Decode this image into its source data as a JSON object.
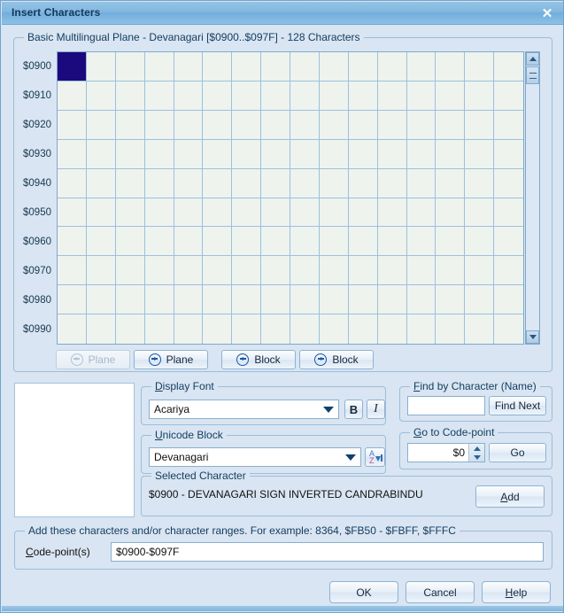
{
  "window": {
    "title": "Insert Characters",
    "close_icon": "close-icon"
  },
  "grid_panel": {
    "legend_prefix": "Basic Multilingual Plane - Devanagari [$0900..$097F] - 128 Characters",
    "legend_plain": "Basic Multilingual Plane - Devanagari [$0900..$097F] - 128 Characters",
    "row_labels": [
      "$0900",
      "$0910",
      "$0920",
      "$0930",
      "$0940",
      "$0950",
      "$0960",
      "$0970",
      "$0980",
      "$0990"
    ],
    "columns": 16,
    "rows": 10,
    "selected_index": 0,
    "selected_color": "#1b0a7d",
    "cell_background": "#eef3ee",
    "gridline_color": "#9dc0dd",
    "scrollbar": {
      "up_icon": "scroll-up-arrow-icon",
      "down_icon": "scroll-down-arrow-icon",
      "thumb": "scrollbar-thumb"
    }
  },
  "nav_buttons": [
    {
      "label": "Plane",
      "direction": "left",
      "disabled": true,
      "icon": "arrow-left-circle-icon"
    },
    {
      "label": "Plane",
      "direction": "right",
      "disabled": false,
      "icon": "arrow-right-circle-icon"
    },
    {
      "label": "Block",
      "direction": "left",
      "disabled": false,
      "icon": "arrow-left-circle-icon"
    },
    {
      "label": "Block",
      "direction": "right",
      "disabled": false,
      "icon": "arrow-right-circle-icon"
    }
  ],
  "display_font": {
    "legend_head": "D",
    "legend_tail": "isplay Font",
    "value": "Acariya",
    "bold_label": "B",
    "italic_label": "I"
  },
  "unicode_block": {
    "legend_head": "U",
    "legend_tail": "nicode Block",
    "value": "Devanagari",
    "sort_icon": "sort-alpha-descending-icon",
    "sort_a": "A",
    "sort_z": "Z"
  },
  "selected_character": {
    "legend": "Selected Character",
    "text": "$0900 - DEVANAGARI SIGN INVERTED CANDRABINDU",
    "add_head": "A",
    "add_tail": "dd"
  },
  "find_by_character": {
    "legend_head": "F",
    "legend_tail": "ind by Character (Name)",
    "input_value": "",
    "input_placeholder": "",
    "button_label": "Find Next"
  },
  "go_to_codepoint": {
    "legend_head": "G",
    "legend_tail": "o to Code-point",
    "spinner_value": "$0",
    "button_label": "Go",
    "spin_up_icon": "spinner-up-icon",
    "spin_down_icon": "spinner-down-icon"
  },
  "codepoint_range": {
    "legend": "Add these characters and/or character ranges. For example: 8364, $FB50 - $FBFF, $FFFC",
    "label_head": "C",
    "label_tail": "ode-point(s)",
    "value": "$0900-$097F"
  },
  "bottom_buttons": {
    "ok": "OK",
    "cancel": "Cancel",
    "help_head": "H",
    "help_tail": "elp"
  }
}
